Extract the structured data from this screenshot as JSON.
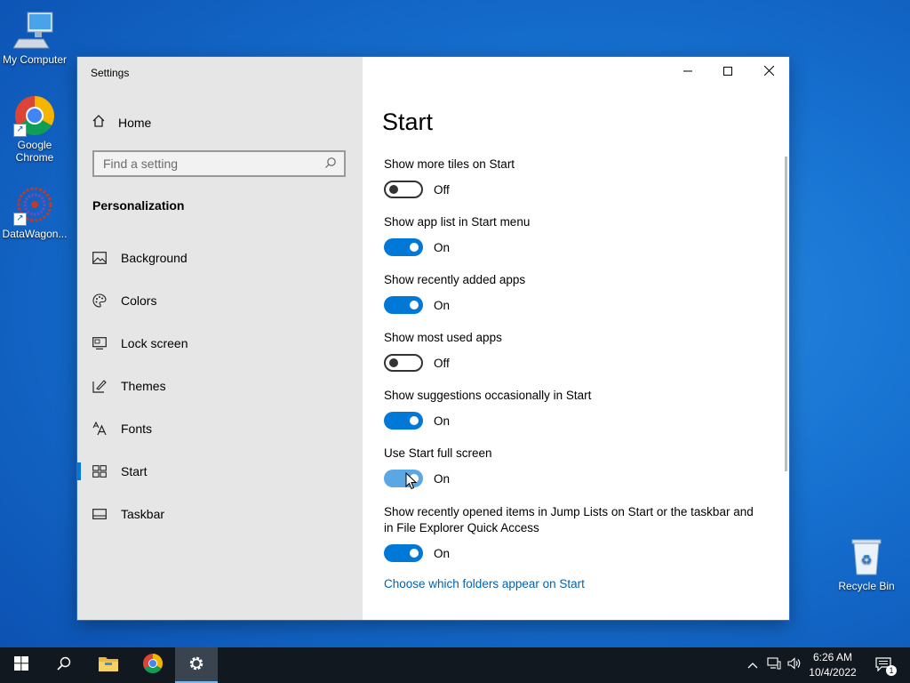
{
  "desktop": {
    "icons": [
      {
        "label": "My Computer"
      },
      {
        "label": "Google Chrome"
      },
      {
        "label": "DataWagon..."
      },
      {
        "label": "Recycle Bin"
      }
    ]
  },
  "window": {
    "title": "Settings",
    "controls": {
      "minimize": "minimize-icon",
      "maximize": "maximize-icon",
      "close": "close-icon"
    }
  },
  "sidebar": {
    "home_label": "Home",
    "search_placeholder": "Find a setting",
    "section_title": "Personalization",
    "items": [
      {
        "label": "Background",
        "icon": "picture-icon"
      },
      {
        "label": "Colors",
        "icon": "palette-icon"
      },
      {
        "label": "Lock screen",
        "icon": "monitor-icon"
      },
      {
        "label": "Themes",
        "icon": "brush-icon"
      },
      {
        "label": "Fonts",
        "icon": "font-icon"
      },
      {
        "label": "Start",
        "icon": "start-grid-icon",
        "selected": true
      },
      {
        "label": "Taskbar",
        "icon": "taskbar-icon"
      }
    ]
  },
  "main": {
    "title": "Start",
    "settings": [
      {
        "label": "Show more tiles on Start",
        "state": "Off"
      },
      {
        "label": "Show app list in Start menu",
        "state": "On"
      },
      {
        "label": "Show recently added apps",
        "state": "On"
      },
      {
        "label": "Show most used apps",
        "state": "Off"
      },
      {
        "label": "Show suggestions occasionally in Start",
        "state": "On"
      },
      {
        "label": "Use Start full screen",
        "state": "On"
      },
      {
        "label": "Show recently opened items in Jump Lists on Start or the taskbar and in File Explorer Quick Access",
        "state": "On"
      }
    ],
    "link": "Choose which folders appear on Start"
  },
  "taskbar": {
    "clock_time": "6:26 AM",
    "clock_date": "10/4/2022",
    "notification_count": "1"
  },
  "colors": {
    "accent": "#0078d7",
    "link": "#0063b1",
    "sidebar_bg": "#e6e6e6",
    "taskbar_bg": "#111820"
  }
}
